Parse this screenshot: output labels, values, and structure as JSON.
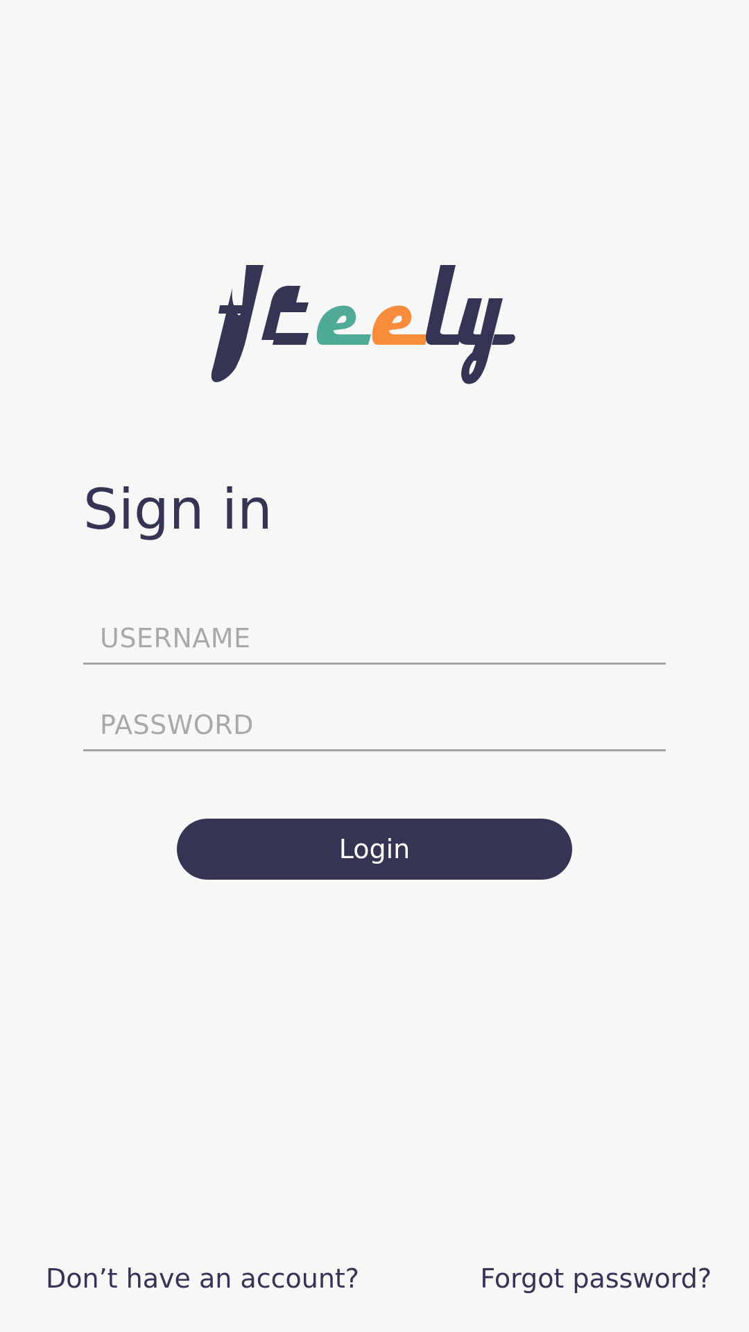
{
  "logo": {
    "text": "freely",
    "colors": {
      "primary": "#363455",
      "teal": "#4fab97",
      "orange": "#f98c3a"
    }
  },
  "title": "Sign in",
  "form": {
    "username_placeholder": "USERNAME",
    "password_placeholder": "PASSWORD",
    "username_value": "",
    "password_value": ""
  },
  "login_button": {
    "label": "Login",
    "color": "#363455"
  },
  "footer": {
    "signup_link": "Don’t have an account?",
    "forgot_link": "Forgot password?"
  },
  "background_color": "#f7f7f8"
}
